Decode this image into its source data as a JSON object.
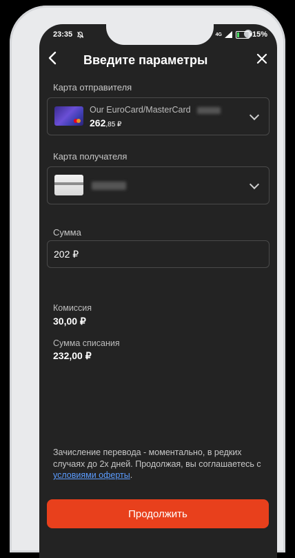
{
  "status": {
    "time": "23:35",
    "network": "4G",
    "battery": "15%"
  },
  "header": {
    "title": "Введите параметры"
  },
  "sender": {
    "label": "Карта отправителя",
    "card_name": "Our EuroCard/MasterCard",
    "balance_int": "262",
    "balance_frac": ",85 ₽"
  },
  "recipient": {
    "label": "Карта получателя"
  },
  "amount": {
    "label": "Сумма",
    "value": "202 ₽"
  },
  "commission": {
    "label": "Комиссия",
    "value": "30,00 ₽"
  },
  "debit": {
    "label": "Сумма списания",
    "value": "232,00 ₽"
  },
  "note": {
    "text": "Зачисление перевода - моментально, в редких случаях до 2х дней. Продолжая, вы соглашаетесь с ",
    "link": "условиями оферты",
    "end": "."
  },
  "continue_label": "Продолжить",
  "colors": {
    "accent": "#e8401c",
    "link": "#5b9cff",
    "background": "#232323"
  }
}
